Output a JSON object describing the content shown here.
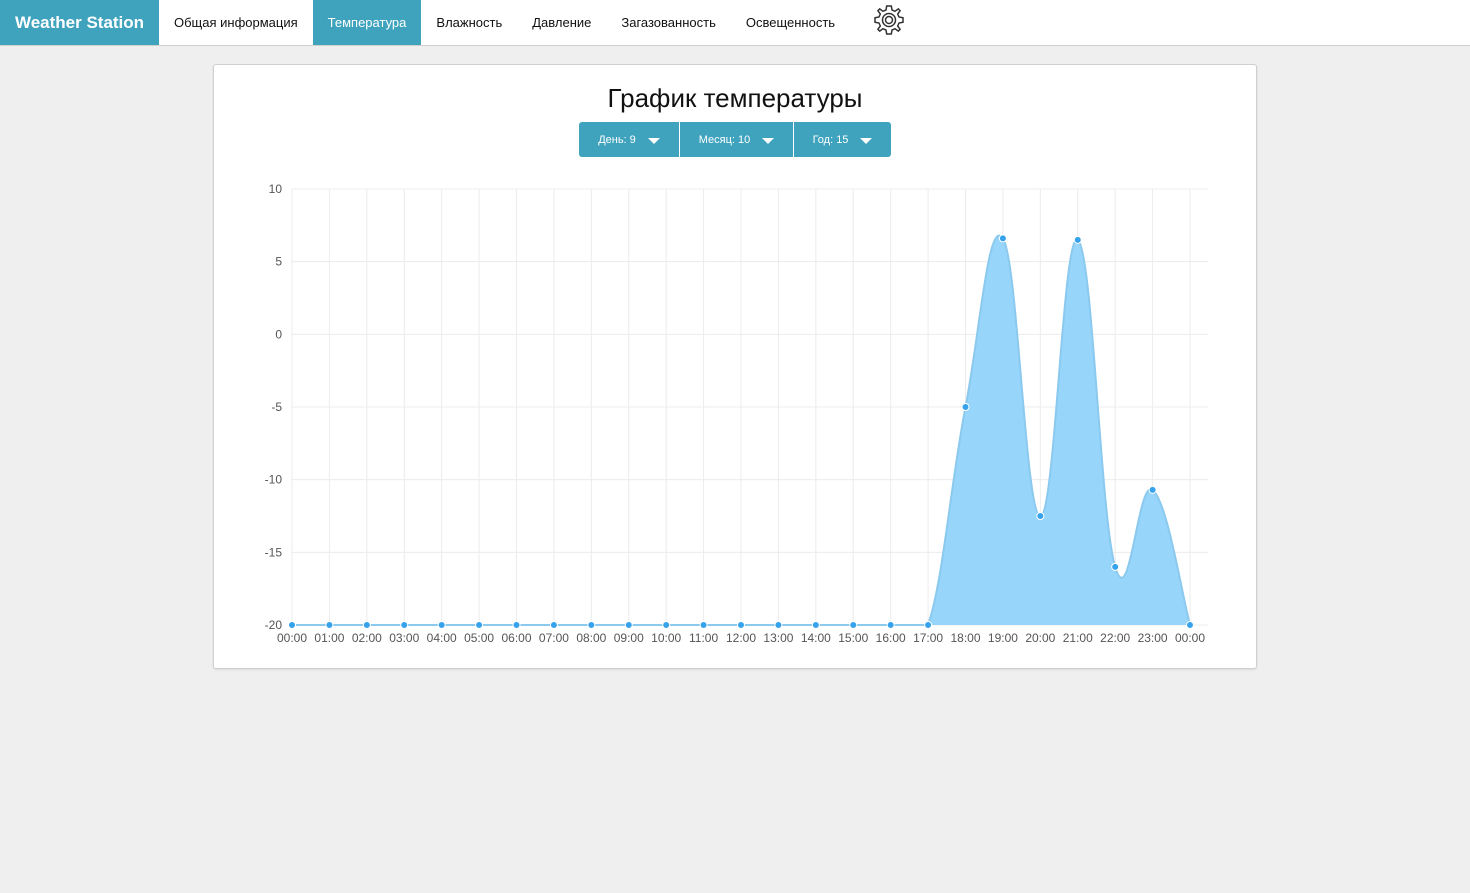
{
  "navbar": {
    "brand": "Weather Station",
    "items": [
      {
        "label": "Общая информация",
        "active": false
      },
      {
        "label": "Температура",
        "active": true
      },
      {
        "label": "Влажность",
        "active": false
      },
      {
        "label": "Давление",
        "active": false
      },
      {
        "label": "Загазованность",
        "active": false
      },
      {
        "label": "Освещенность",
        "active": false
      }
    ],
    "settings_icon": "gear-icon"
  },
  "panel": {
    "title": "График температуры",
    "filters": {
      "day": "День: 9",
      "month": "Месяц: 10",
      "year": "Год: 15"
    }
  },
  "colors": {
    "accent": "#3fa3bd",
    "area_fill": "#97d5fa",
    "line": "#8cc9ee",
    "point": "#36a2eb"
  },
  "chart_data": {
    "type": "area",
    "categories": [
      "00:00",
      "01:00",
      "02:00",
      "03:00",
      "04:00",
      "05:00",
      "06:00",
      "07:00",
      "08:00",
      "09:00",
      "10:00",
      "11:00",
      "12:00",
      "13:00",
      "14:00",
      "15:00",
      "16:00",
      "17:00",
      "18:00",
      "19:00",
      "20:00",
      "21:00",
      "22:00",
      "23:00",
      "00:00"
    ],
    "values": [
      -20,
      -20,
      -20,
      -20,
      -20,
      -20,
      -20,
      -20,
      -20,
      -20,
      -20,
      -20,
      -20,
      -20,
      -20,
      -20,
      -20,
      -20,
      -5,
      6.6,
      -12.5,
      6.5,
      -16,
      -10.7,
      -20
    ],
    "yticks": [
      10,
      5,
      0,
      -5,
      -10,
      -15,
      -20
    ],
    "ylim": [
      -20,
      10
    ],
    "grid": true,
    "title": "",
    "xlabel": "",
    "ylabel": ""
  }
}
